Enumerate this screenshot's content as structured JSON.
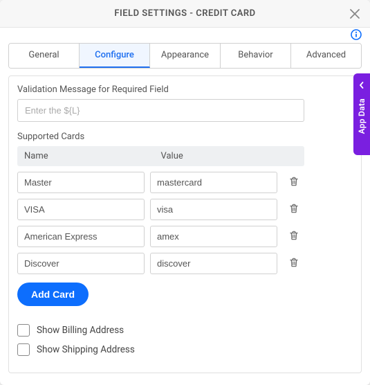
{
  "header": {
    "title": "FIELD SETTINGS - CREDIT CARD"
  },
  "tabs": [
    {
      "label": "General"
    },
    {
      "label": "Configure"
    },
    {
      "label": "Appearance"
    },
    {
      "label": "Behavior"
    },
    {
      "label": "Advanced"
    }
  ],
  "active_tab_index": 1,
  "configure": {
    "validation_label": "Validation Message for Required Field",
    "validation_placeholder": "Enter the ${L}",
    "supported_cards_label": "Supported Cards",
    "columns": {
      "name": "Name",
      "value": "Value"
    },
    "cards": [
      {
        "name": "Master",
        "value": "mastercard"
      },
      {
        "name": "VISA",
        "value": "visa"
      },
      {
        "name": "American Express",
        "value": "amex"
      },
      {
        "name": "Discover",
        "value": "discover"
      }
    ],
    "add_button": "Add Card",
    "billing_label": "Show Billing Address",
    "shipping_label": "Show Shipping Address"
  },
  "side_panel": {
    "label": "App Data"
  }
}
